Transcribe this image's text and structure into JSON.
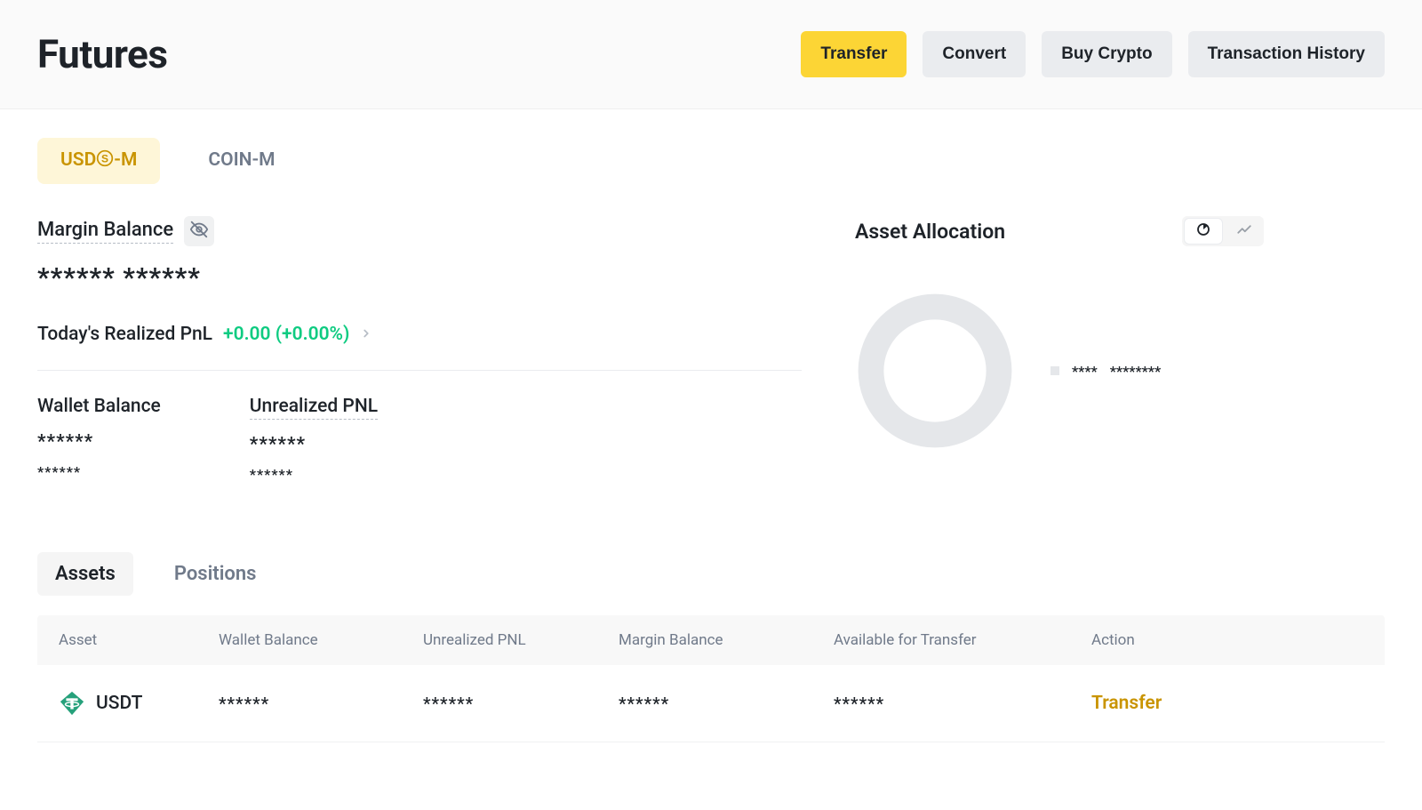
{
  "header": {
    "title": "Futures",
    "buttons": {
      "transfer": "Transfer",
      "convert": "Convert",
      "buy_crypto": "Buy Crypto",
      "history": "Transaction History"
    }
  },
  "futures_tabs": {
    "usdsm_prefix": "USD",
    "usdsm_suffix": "-M",
    "coinm": "COIN-M"
  },
  "margin": {
    "label": "Margin Balance",
    "value_masked": "****** ******"
  },
  "pnl": {
    "label": "Today's Realized PnL",
    "value": "+0.00 (+0.00%)"
  },
  "balances": {
    "wallet_label": "Wallet Balance",
    "wallet_val1": "******",
    "wallet_val2": "******",
    "unrealized_label": "Unrealized PNL",
    "unrealized_val1": "******",
    "unrealized_val2": "******"
  },
  "allocation": {
    "title": "Asset Allocation",
    "legend_name": "****",
    "legend_value": "********"
  },
  "sub_tabs": {
    "assets": "Assets",
    "positions": "Positions"
  },
  "table": {
    "headers": {
      "asset": "Asset",
      "wallet": "Wallet Balance",
      "unrealized": "Unrealized PNL",
      "margin": "Margin Balance",
      "available": "Available for Transfer",
      "action": "Action"
    },
    "rows": [
      {
        "symbol": "USDT",
        "wallet": "******",
        "unrealized": "******",
        "margin": "******",
        "available": "******",
        "action": "Transfer"
      }
    ]
  },
  "chart_data": {
    "type": "pie",
    "title": "Asset Allocation",
    "series": [
      {
        "name": "****",
        "value_label": "********"
      }
    ],
    "note": "values hidden / masked"
  }
}
